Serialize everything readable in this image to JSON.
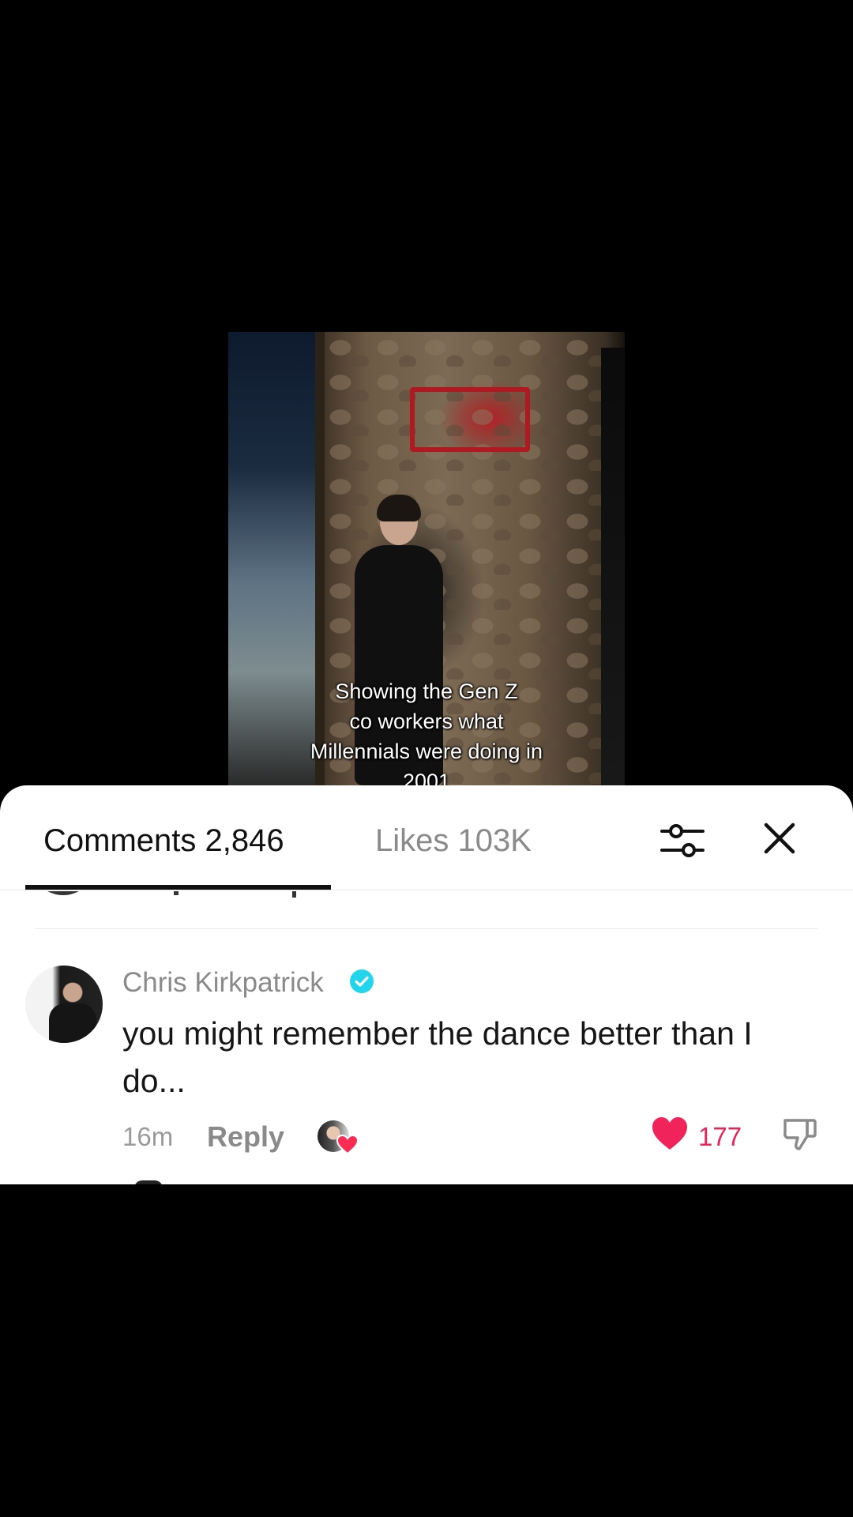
{
  "video": {
    "caption": "Showing the Gen Z\nco workers what\nMillennials were doing in\n2001"
  },
  "sheet": {
    "tabs": [
      {
        "label": "Comments",
        "count": "2,846",
        "active": true
      },
      {
        "label": "Likes",
        "count": "103K",
        "active": false
      }
    ],
    "icons": {
      "filter": "sliders-icon",
      "close": "close-icon"
    }
  },
  "comment": {
    "username": "Chris Kirkpatrick",
    "verified": true,
    "text": "you might remember the dance better than I do...",
    "time": "16m",
    "reply_label": "Reply",
    "like_count": "177",
    "liked_by_creator": true
  },
  "colors": {
    "accent_like": "#e8245b",
    "verified": "#20d5ec",
    "muted_text": "#8a8a8a"
  }
}
